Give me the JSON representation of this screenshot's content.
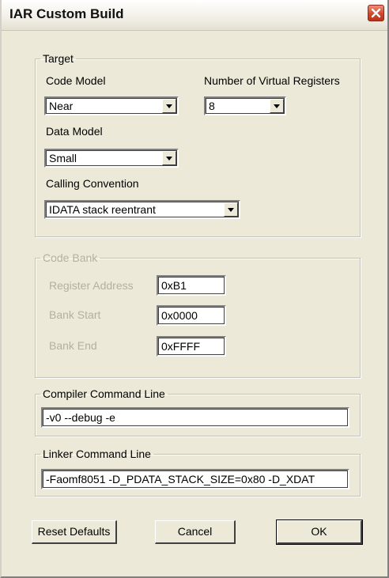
{
  "window": {
    "title": "IAR Custom Build"
  },
  "target": {
    "legend": "Target",
    "code_model_label": "Code Model",
    "code_model_value": "Near",
    "virtual_registers_label": "Number of Virtual Registers",
    "virtual_registers_value": "8",
    "data_model_label": "Data Model",
    "data_model_value": "Small",
    "calling_convention_label": "Calling Convention",
    "calling_convention_value": "IDATA stack reentrant"
  },
  "code_bank": {
    "legend": "Code Bank",
    "register_address_label": "Register Address",
    "register_address_value": "0xB1",
    "bank_start_label": "Bank Start",
    "bank_start_value": "0x0000",
    "bank_end_label": "Bank End",
    "bank_end_value": "0xFFFF"
  },
  "compiler": {
    "legend": "Compiler Command Line",
    "value": "-v0 --debug -e"
  },
  "linker": {
    "legend": "Linker Command Line",
    "value": "-Faomf8051 -D_PDATA_STACK_SIZE=0x80 -D_XDAT"
  },
  "buttons": {
    "reset": "Reset Defaults",
    "cancel": "Cancel",
    "ok": "OK"
  }
}
